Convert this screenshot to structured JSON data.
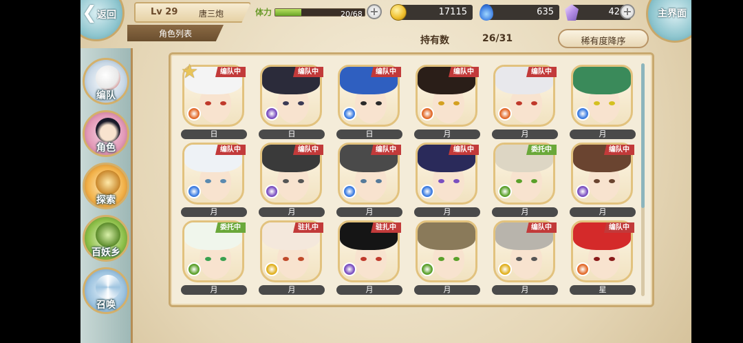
{
  "header": {
    "back_label": "返回",
    "level": "Lv 29",
    "player_name": "唐三炮",
    "stamina_label": "体力",
    "stamina_text": "20/68",
    "stamina_fraction": 0.294,
    "gold": "17115",
    "soul": "635",
    "gems": "42",
    "main_menu_label": "主界面"
  },
  "page": {
    "title": "角色列表",
    "holding_label": "持有数",
    "holding_value": "26/31",
    "sort_label": "稀有度降序"
  },
  "side_menu": [
    {
      "label": "编队",
      "icon": "formation-icon"
    },
    {
      "label": "角色",
      "icon": "character-icon"
    },
    {
      "label": "探索",
      "icon": "explore-icon"
    },
    {
      "label": "百妖乡",
      "icon": "village-icon"
    },
    {
      "label": "召唤",
      "icon": "summon-icon"
    }
  ],
  "colors": {
    "tag_red": "#c23a3a",
    "tag_green": "#6aa83a",
    "element_sun": "#e26a2a",
    "element_moon_blue": "#3a7be0",
    "element_moon_purple": "#7a4fc0",
    "element_green": "#5aa02a",
    "element_yellow": "#e0b020"
  },
  "characters": [
    {
      "label": "日",
      "tag": "编队中",
      "tag_color": "red",
      "element": "sun",
      "hair": "#f4f4f4",
      "eye": "#c0392b",
      "star": true
    },
    {
      "label": "日",
      "tag": "编队中",
      "tag_color": "red",
      "element": "purple",
      "hair": "#2b2b3a",
      "eye": "#3a3a55"
    },
    {
      "label": "日",
      "tag": "编队中",
      "tag_color": "red",
      "element": "blue",
      "hair": "#2f5fc0",
      "eye": "#2a2a2a"
    },
    {
      "label": "月",
      "tag": "编队中",
      "tag_color": "red",
      "element": "sun",
      "hair": "#2a1e18",
      "eye": "#d4a020"
    },
    {
      "label": "月",
      "tag": "编队中",
      "tag_color": "red",
      "element": "sun",
      "hair": "#e8e8ec",
      "eye": "#c0392b"
    },
    {
      "label": "月",
      "tag": "",
      "tag_color": "",
      "element": "blue",
      "hair": "#3a8a5a",
      "eye": "#d4c020"
    },
    {
      "label": "月",
      "tag": "编队中",
      "tag_color": "red",
      "element": "blue",
      "hair": "#eef2f6",
      "eye": "#5a8ab0"
    },
    {
      "label": "月",
      "tag": "编队中",
      "tag_color": "red",
      "element": "purple",
      "hair": "#3a3a3a",
      "eye": "#555"
    },
    {
      "label": "月",
      "tag": "编队中",
      "tag_color": "red",
      "element": "blue",
      "hair": "#4a4a4a",
      "eye": "#557a9a"
    },
    {
      "label": "月",
      "tag": "编队中",
      "tag_color": "red",
      "element": "blue",
      "hair": "#2a2a5a",
      "eye": "#7a4fc0"
    },
    {
      "label": "月",
      "tag": "委托中",
      "tag_color": "green",
      "element": "green",
      "hair": "#ddd6c4",
      "eye": "#5aa02a"
    },
    {
      "label": "月",
      "tag": "编队中",
      "tag_color": "red",
      "element": "purple",
      "hair": "#6a4430",
      "eye": "#6a4430"
    },
    {
      "label": "月",
      "tag": "委托中",
      "tag_color": "green",
      "element": "green",
      "hair": "#f0f6ec",
      "eye": "#3aa050"
    },
    {
      "label": "月",
      "tag": "驻扎中",
      "tag_color": "red",
      "element": "yellow",
      "hair": "#f4e8dc",
      "eye": "#c04a2a"
    },
    {
      "label": "月",
      "tag": "驻扎中",
      "tag_color": "red",
      "element": "purple",
      "hair": "#151515",
      "eye": "#c0392b"
    },
    {
      "label": "月",
      "tag": "",
      "tag_color": "",
      "element": "green",
      "hair": "#8a7a5a",
      "eye": "#5aa02a"
    },
    {
      "label": "月",
      "tag": "编队中",
      "tag_color": "red",
      "element": "yellow",
      "hair": "#b8b4ac",
      "eye": "#555"
    },
    {
      "label": "星",
      "tag": "编队中",
      "tag_color": "red",
      "element": "sun",
      "hair": "#d42a2a",
      "eye": "#8a1a1a"
    }
  ]
}
